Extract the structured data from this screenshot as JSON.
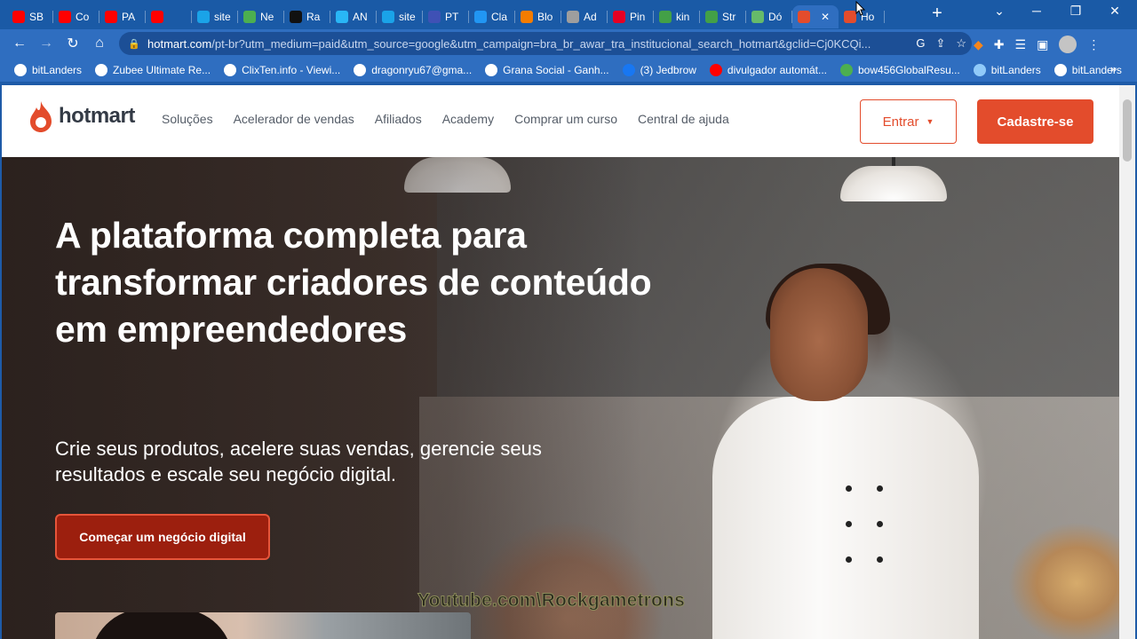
{
  "browser": {
    "tabs": [
      {
        "label": "SB",
        "favicon": "youtube-icon",
        "color": "#ff0000"
      },
      {
        "label": "Co",
        "favicon": "youtube-icon",
        "color": "#ff0000"
      },
      {
        "label": "PA",
        "favicon": "youtube-icon",
        "color": "#ff0000"
      },
      {
        "label": "",
        "favicon": "youtube-icon",
        "color": "#ff0000"
      },
      {
        "label": "site",
        "favicon": "c-icon",
        "color": "#1aa3e8"
      },
      {
        "label": "Ne",
        "favicon": "grid-icon",
        "color": "#4caf50"
      },
      {
        "label": "Ra",
        "favicon": "r-icon",
        "color": "#111111"
      },
      {
        "label": "AN",
        "favicon": "globe-icon",
        "color": "#29b6f6"
      },
      {
        "label": "site",
        "favicon": "c-icon",
        "color": "#1aa3e8"
      },
      {
        "label": "PT",
        "favicon": "p-icon",
        "color": "#3f51b5"
      },
      {
        "label": "Cla",
        "favicon": "drop-icon",
        "color": "#2196f3"
      },
      {
        "label": "Blo",
        "favicon": "blogger-icon",
        "color": "#f57c00"
      },
      {
        "label": "Ad",
        "favicon": "ad-icon",
        "color": "#9e9e9e"
      },
      {
        "label": "Pin",
        "favicon": "pinterest-icon",
        "color": "#e60023"
      },
      {
        "label": "kin",
        "favicon": "leaf-icon",
        "color": "#43a047"
      },
      {
        "label": "Str",
        "favicon": "leaf-icon",
        "color": "#43a047"
      },
      {
        "label": "Dó",
        "favicon": "dollar-icon",
        "color": "#66bb6a"
      },
      {
        "label": "",
        "favicon": "hotmart-icon",
        "color": "#e34c2c",
        "active": true
      },
      {
        "label": "Ho",
        "favicon": "hotmart-icon",
        "color": "#e34c2c"
      }
    ],
    "url_host": "hotmart.com",
    "url_path": "/pt-br?utm_medium=paid&utm_source=google&utm_campaign=bra_br_awar_tra_institucional_search_hotmart&gclid=Cj0KCQi...",
    "bookmarks": [
      {
        "label": "bitLanders",
        "favicon": "gear-icon",
        "color": "#ffffff"
      },
      {
        "label": "Zubee Ultimate Re...",
        "favicon": "gear-icon",
        "color": "#ffffff"
      },
      {
        "label": "ClixTen.info - Viewi...",
        "favicon": "gear-icon",
        "color": "#ffffff"
      },
      {
        "label": "dragonryu67@gma...",
        "favicon": "google-icon",
        "color": "#ffffff"
      },
      {
        "label": "Grana Social - Ganh...",
        "favicon": "gs-icon",
        "color": "#ffffff"
      },
      {
        "label": "(3) Jedbrow",
        "favicon": "facebook-icon",
        "color": "#1877f2"
      },
      {
        "label": "divulgador automát...",
        "favicon": "youtube-icon",
        "color": "#ff0000"
      },
      {
        "label": "bow456GlobalResu...",
        "favicon": "x-icon",
        "color": "#4caf50"
      },
      {
        "label": "bitLanders",
        "favicon": "image-icon",
        "color": "#90caf9"
      },
      {
        "label": "bitLanders",
        "favicon": "gear-icon",
        "color": "#ffffff"
      }
    ],
    "bookmarks_more": "»",
    "new_tab": "+",
    "win_min": "─",
    "win_max": "❐",
    "win_close": "✕"
  },
  "site": {
    "logo_text": "hotmart",
    "nav": [
      "Soluções",
      "Acelerador de vendas",
      "Afiliados",
      "Academy",
      "Comprar um curso",
      "Central de ajuda"
    ],
    "login_label": "Entrar",
    "signup_label": "Cadastre-se",
    "brand_color": "#e34c2c"
  },
  "hero": {
    "headline": "A plataforma completa para transformar criadores de conteúdo em empreendedores",
    "subheadline": "Crie seus produtos, acelere suas vendas, gerencie seus resultados e escale seu negócio digital.",
    "cta_label": "Começar um negócio digital"
  },
  "overlay": {
    "watermark": "Youtube.com\\Rockgametrons"
  }
}
